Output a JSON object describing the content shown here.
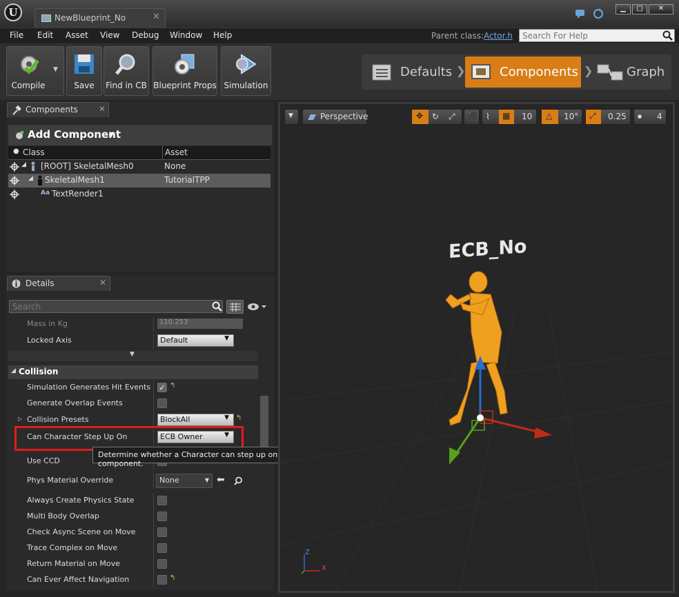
{
  "window": {
    "tab_title": "NewBlueprint_No",
    "tab_close": "✕",
    "controls": {
      "minimize": "▁",
      "maximize": "□",
      "close": "✕"
    }
  },
  "menu": {
    "items": [
      "File",
      "Edit",
      "Asset",
      "View",
      "Debug",
      "Window",
      "Help"
    ],
    "parent_class_label": "Parent class:",
    "parent_class_value": "Actor.h",
    "help_search_placeholder": "Search For Help"
  },
  "toolbar": {
    "buttons": [
      "Compile",
      "Save",
      "Find in CB",
      "Blueprint Props",
      "Simulation"
    ]
  },
  "modes": {
    "items": [
      "Defaults",
      "Components",
      "Graph"
    ],
    "active": "Components"
  },
  "components_panel": {
    "tab_label": "Components",
    "add_button": "Add Component",
    "columns": [
      "Class",
      "Asset"
    ],
    "rows": [
      {
        "class": "[ROOT] SkeletalMesh0",
        "asset": "None"
      },
      {
        "class": "SkeletalMesh1",
        "asset": "TutorialTPP"
      },
      {
        "class": "TextRender1",
        "asset": ""
      }
    ]
  },
  "details_panel": {
    "tab_label": "Details",
    "search_placeholder": "Search",
    "physics": {
      "mass_label": "Mass in Kg",
      "mass_value": "110.253",
      "locked_axis_label": "Locked Axis",
      "locked_axis_value": "Default"
    },
    "collision": {
      "header": "Collision",
      "simulation_hit_events": "Simulation Generates Hit Events",
      "overlap_events": "Generate Overlap Events",
      "collision_presets_label": "Collision Presets",
      "collision_presets_value": "BlockAll",
      "step_up_label": "Can Character Step Up On",
      "step_up_value": "ECB Owner",
      "use_ccd": "Use CCD",
      "phys_material_label": "Phys Material Override",
      "phys_material_value": "None",
      "always_create": "Always Create Physics State",
      "multi_body": "Multi Body Overlap",
      "check_async": "Check Async Scene on Move",
      "trace_complex": "Trace Complex on Move",
      "return_material": "Return Material on Move",
      "affect_navigation": "Can Ever Affect Navigation"
    },
    "tooltip": "Determine whether a Character can step up onto this component."
  },
  "viewport": {
    "perspective": "Perspective",
    "grid_snap": "10",
    "rot_snap": "10°",
    "scale_snap": "0.25",
    "camera_speed": "4",
    "character_label": "ECB_No",
    "axis_z": "Z",
    "axis_x": "X"
  }
}
